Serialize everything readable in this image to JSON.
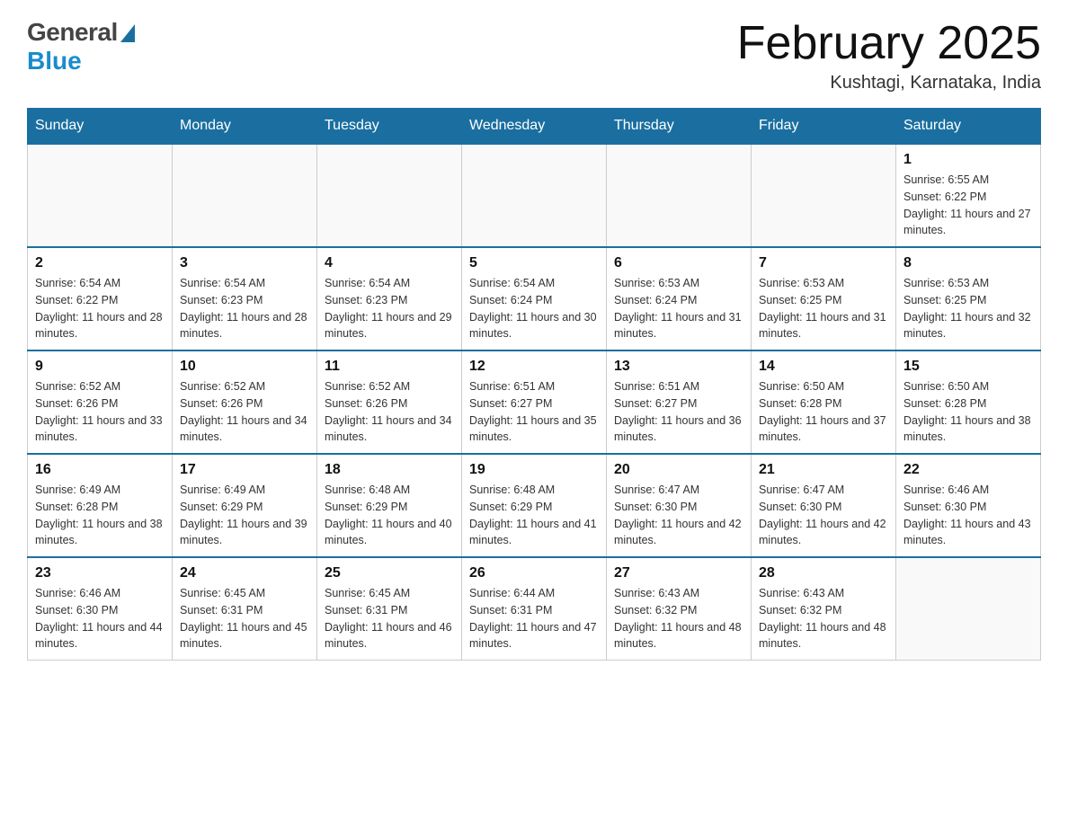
{
  "header": {
    "logo_general": "General",
    "logo_blue": "Blue",
    "title": "February 2025",
    "subtitle": "Kushtagi, Karnataka, India"
  },
  "weekdays": [
    "Sunday",
    "Monday",
    "Tuesday",
    "Wednesday",
    "Thursday",
    "Friday",
    "Saturday"
  ],
  "weeks": [
    [
      {
        "day": "",
        "sunrise": "",
        "sunset": "",
        "daylight": "",
        "empty": true
      },
      {
        "day": "",
        "sunrise": "",
        "sunset": "",
        "daylight": "",
        "empty": true
      },
      {
        "day": "",
        "sunrise": "",
        "sunset": "",
        "daylight": "",
        "empty": true
      },
      {
        "day": "",
        "sunrise": "",
        "sunset": "",
        "daylight": "",
        "empty": true
      },
      {
        "day": "",
        "sunrise": "",
        "sunset": "",
        "daylight": "",
        "empty": true
      },
      {
        "day": "",
        "sunrise": "",
        "sunset": "",
        "daylight": "",
        "empty": true
      },
      {
        "day": "1",
        "sunrise": "Sunrise: 6:55 AM",
        "sunset": "Sunset: 6:22 PM",
        "daylight": "Daylight: 11 hours and 27 minutes.",
        "empty": false
      }
    ],
    [
      {
        "day": "2",
        "sunrise": "Sunrise: 6:54 AM",
        "sunset": "Sunset: 6:22 PM",
        "daylight": "Daylight: 11 hours and 28 minutes.",
        "empty": false
      },
      {
        "day": "3",
        "sunrise": "Sunrise: 6:54 AM",
        "sunset": "Sunset: 6:23 PM",
        "daylight": "Daylight: 11 hours and 28 minutes.",
        "empty": false
      },
      {
        "day": "4",
        "sunrise": "Sunrise: 6:54 AM",
        "sunset": "Sunset: 6:23 PM",
        "daylight": "Daylight: 11 hours and 29 minutes.",
        "empty": false
      },
      {
        "day": "5",
        "sunrise": "Sunrise: 6:54 AM",
        "sunset": "Sunset: 6:24 PM",
        "daylight": "Daylight: 11 hours and 30 minutes.",
        "empty": false
      },
      {
        "day": "6",
        "sunrise": "Sunrise: 6:53 AM",
        "sunset": "Sunset: 6:24 PM",
        "daylight": "Daylight: 11 hours and 31 minutes.",
        "empty": false
      },
      {
        "day": "7",
        "sunrise": "Sunrise: 6:53 AM",
        "sunset": "Sunset: 6:25 PM",
        "daylight": "Daylight: 11 hours and 31 minutes.",
        "empty": false
      },
      {
        "day": "8",
        "sunrise": "Sunrise: 6:53 AM",
        "sunset": "Sunset: 6:25 PM",
        "daylight": "Daylight: 11 hours and 32 minutes.",
        "empty": false
      }
    ],
    [
      {
        "day": "9",
        "sunrise": "Sunrise: 6:52 AM",
        "sunset": "Sunset: 6:26 PM",
        "daylight": "Daylight: 11 hours and 33 minutes.",
        "empty": false
      },
      {
        "day": "10",
        "sunrise": "Sunrise: 6:52 AM",
        "sunset": "Sunset: 6:26 PM",
        "daylight": "Daylight: 11 hours and 34 minutes.",
        "empty": false
      },
      {
        "day": "11",
        "sunrise": "Sunrise: 6:52 AM",
        "sunset": "Sunset: 6:26 PM",
        "daylight": "Daylight: 11 hours and 34 minutes.",
        "empty": false
      },
      {
        "day": "12",
        "sunrise": "Sunrise: 6:51 AM",
        "sunset": "Sunset: 6:27 PM",
        "daylight": "Daylight: 11 hours and 35 minutes.",
        "empty": false
      },
      {
        "day": "13",
        "sunrise": "Sunrise: 6:51 AM",
        "sunset": "Sunset: 6:27 PM",
        "daylight": "Daylight: 11 hours and 36 minutes.",
        "empty": false
      },
      {
        "day": "14",
        "sunrise": "Sunrise: 6:50 AM",
        "sunset": "Sunset: 6:28 PM",
        "daylight": "Daylight: 11 hours and 37 minutes.",
        "empty": false
      },
      {
        "day": "15",
        "sunrise": "Sunrise: 6:50 AM",
        "sunset": "Sunset: 6:28 PM",
        "daylight": "Daylight: 11 hours and 38 minutes.",
        "empty": false
      }
    ],
    [
      {
        "day": "16",
        "sunrise": "Sunrise: 6:49 AM",
        "sunset": "Sunset: 6:28 PM",
        "daylight": "Daylight: 11 hours and 38 minutes.",
        "empty": false
      },
      {
        "day": "17",
        "sunrise": "Sunrise: 6:49 AM",
        "sunset": "Sunset: 6:29 PM",
        "daylight": "Daylight: 11 hours and 39 minutes.",
        "empty": false
      },
      {
        "day": "18",
        "sunrise": "Sunrise: 6:48 AM",
        "sunset": "Sunset: 6:29 PM",
        "daylight": "Daylight: 11 hours and 40 minutes.",
        "empty": false
      },
      {
        "day": "19",
        "sunrise": "Sunrise: 6:48 AM",
        "sunset": "Sunset: 6:29 PM",
        "daylight": "Daylight: 11 hours and 41 minutes.",
        "empty": false
      },
      {
        "day": "20",
        "sunrise": "Sunrise: 6:47 AM",
        "sunset": "Sunset: 6:30 PM",
        "daylight": "Daylight: 11 hours and 42 minutes.",
        "empty": false
      },
      {
        "day": "21",
        "sunrise": "Sunrise: 6:47 AM",
        "sunset": "Sunset: 6:30 PM",
        "daylight": "Daylight: 11 hours and 42 minutes.",
        "empty": false
      },
      {
        "day": "22",
        "sunrise": "Sunrise: 6:46 AM",
        "sunset": "Sunset: 6:30 PM",
        "daylight": "Daylight: 11 hours and 43 minutes.",
        "empty": false
      }
    ],
    [
      {
        "day": "23",
        "sunrise": "Sunrise: 6:46 AM",
        "sunset": "Sunset: 6:30 PM",
        "daylight": "Daylight: 11 hours and 44 minutes.",
        "empty": false
      },
      {
        "day": "24",
        "sunrise": "Sunrise: 6:45 AM",
        "sunset": "Sunset: 6:31 PM",
        "daylight": "Daylight: 11 hours and 45 minutes.",
        "empty": false
      },
      {
        "day": "25",
        "sunrise": "Sunrise: 6:45 AM",
        "sunset": "Sunset: 6:31 PM",
        "daylight": "Daylight: 11 hours and 46 minutes.",
        "empty": false
      },
      {
        "day": "26",
        "sunrise": "Sunrise: 6:44 AM",
        "sunset": "Sunset: 6:31 PM",
        "daylight": "Daylight: 11 hours and 47 minutes.",
        "empty": false
      },
      {
        "day": "27",
        "sunrise": "Sunrise: 6:43 AM",
        "sunset": "Sunset: 6:32 PM",
        "daylight": "Daylight: 11 hours and 48 minutes.",
        "empty": false
      },
      {
        "day": "28",
        "sunrise": "Sunrise: 6:43 AM",
        "sunset": "Sunset: 6:32 PM",
        "daylight": "Daylight: 11 hours and 48 minutes.",
        "empty": false
      },
      {
        "day": "",
        "sunrise": "",
        "sunset": "",
        "daylight": "",
        "empty": true
      }
    ]
  ]
}
